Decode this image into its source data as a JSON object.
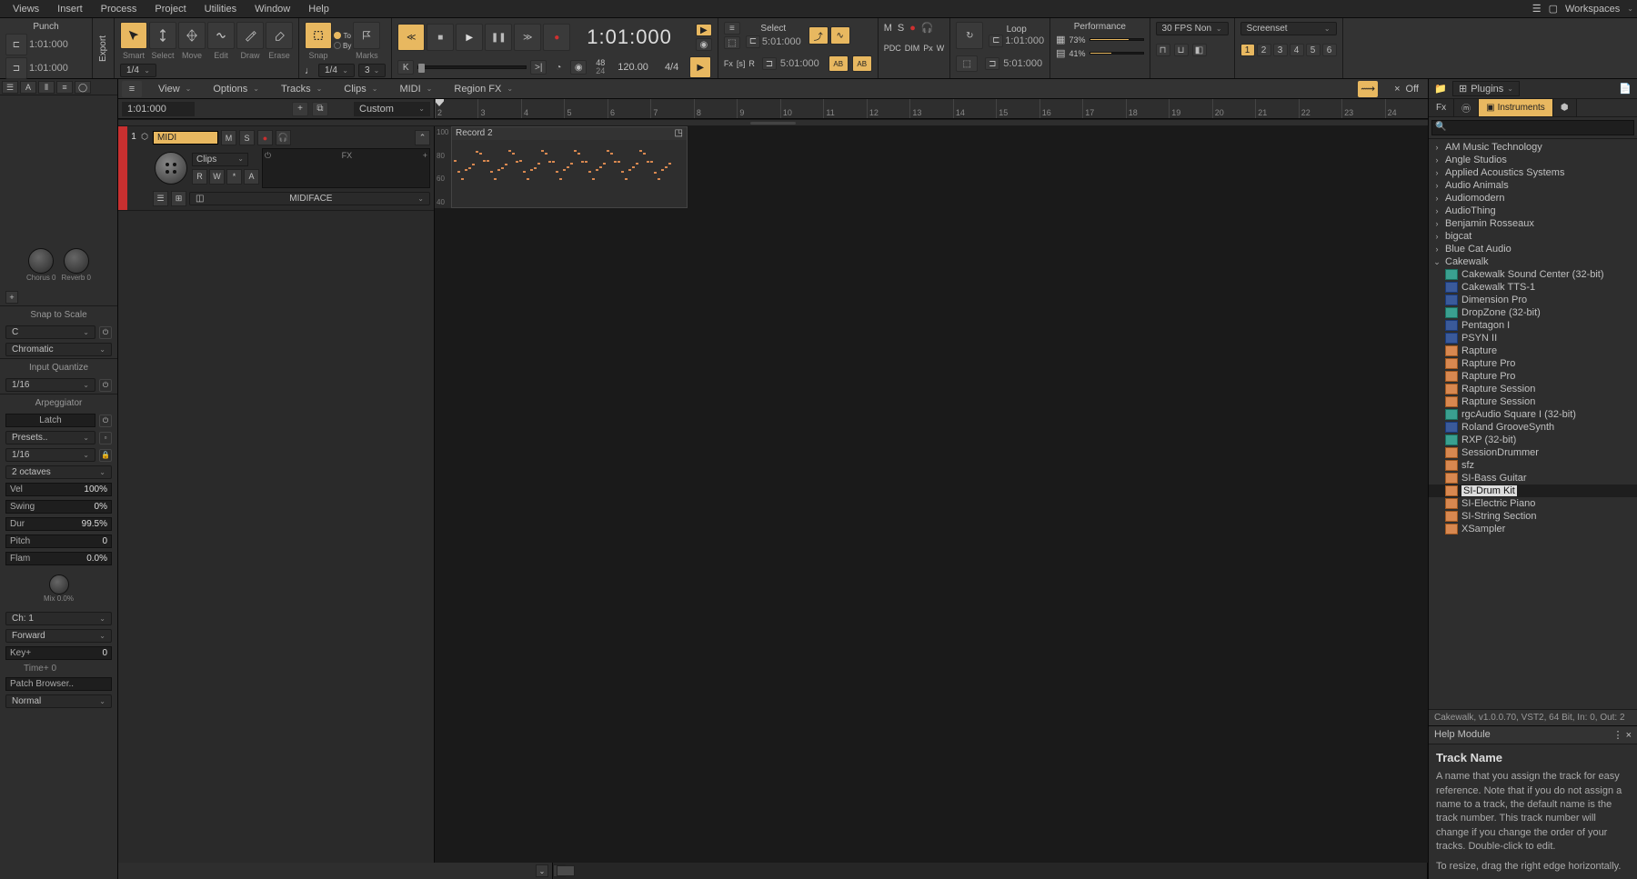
{
  "menu": {
    "items": [
      "Views",
      "Insert",
      "Process",
      "Project",
      "Utilities",
      "Window",
      "Help"
    ],
    "workspaces": "Workspaces"
  },
  "toolbar": {
    "punch": {
      "label": "Punch",
      "in": "1:01:000",
      "out": "1:01:000"
    },
    "export": "Export",
    "tools": {
      "smart": "Smart",
      "select": "Select",
      "move": "Move",
      "edit": "Edit",
      "draw": "Draw",
      "erase": "Erase"
    },
    "snap": {
      "label": "Snap",
      "toby": "To\nBy",
      "marks": "Marks",
      "val1": "1/4",
      "val2": "1/4",
      "step": "3"
    },
    "transport": {
      "now": "1:01:000",
      "meas": "48",
      "beat": "24",
      "tempo": "120.00",
      "sig": "4/4"
    },
    "select": {
      "label": "Select",
      "from": "5:01:000",
      "to": "5:01:000",
      "fx": "Fx",
      "s": "[s]",
      "r": "R",
      "ab1": "AB",
      "ab2": "AB"
    },
    "mix": {
      "m": "M",
      "s": "S",
      "pdc": "PDC",
      "dim": "DIM",
      "px": "Px",
      "w": "W"
    },
    "loop": {
      "label": "Loop",
      "from": "1:01:000",
      "to": "5:01:000"
    },
    "perf": {
      "label": "Performance",
      "cpu_pct": "73%",
      "disk_pct": "41%",
      "cpu": 73,
      "disk": 41
    },
    "fps": "30 FPS Non",
    "screenset_label": "Screenset",
    "screenset": [
      "1",
      "2",
      "3",
      "4",
      "5",
      "6"
    ]
  },
  "trackbar": {
    "view": "View",
    "options": "Options",
    "tracks": "Tracks",
    "clips": "Clips",
    "midi": "MIDI",
    "regionfx": "Region FX",
    "off": "Off"
  },
  "trackheader": {
    "pos": "1:01:000",
    "custom": "Custom",
    "marks": [
      "2",
      "3",
      "4",
      "5",
      "6",
      "7",
      "8",
      "9",
      "10",
      "11",
      "12",
      "13",
      "14",
      "15",
      "16",
      "17",
      "18",
      "19",
      "20",
      "21",
      "22",
      "23",
      "24"
    ]
  },
  "track1": {
    "num": "1",
    "name": "MIDI",
    "m": "M",
    "s": "S",
    "clips": "Clips",
    "r": "R",
    "w": "W",
    "star": "*",
    "a": "A",
    "midiface": "MIDIFACE",
    "fx": "FX"
  },
  "clip": {
    "name": "Record 2",
    "vel": [
      "100",
      "80",
      "60",
      "40"
    ]
  },
  "inspector": {
    "chorus": "Chorus 0",
    "reverb": "Reverb 0",
    "snap_scale": "Snap to Scale",
    "key": "C",
    "scale": "Chromatic",
    "input_q": "Input Quantize",
    "iq_val": "1/16",
    "arp": "Arpeggiator",
    "latch": "Latch",
    "presets": "Presets..",
    "rate": "1/16",
    "octaves": "2 octaves",
    "vel": "Vel",
    "vel_v": "100%",
    "swing": "Swing",
    "swing_v": "0%",
    "dur": "Dur",
    "dur_v": "99.5%",
    "pitch": "Pitch",
    "pitch_v": "0",
    "flam": "Flam",
    "flam_v": "0.0%",
    "mix": "Mix 0.0%",
    "ch": "Ch: 1",
    "fwd": "Forward",
    "keyplus": "Key+",
    "keyplus_v": "0",
    "timeplus": "Time+ 0",
    "patch": "Patch Browser..",
    "normal": "Normal"
  },
  "browser": {
    "plugins": "Plugins",
    "tabs": {
      "fx": "Fx",
      "inst": "Instruments"
    },
    "search_ph": "",
    "vendors": [
      "AM Music Technology",
      "Angle Studios",
      "Applied Acoustics Systems",
      "Audio Animals",
      "Audiomodern",
      "AudioThing",
      "Benjamin Rosseaux",
      "bigcat",
      "Blue Cat Audio",
      "Cakewalk"
    ],
    "cakewalk_items": [
      {
        "name": "Cakewalk Sound Center (32-bit)",
        "ico": "teal"
      },
      {
        "name": "Cakewalk TTS-1",
        "ico": "navy"
      },
      {
        "name": "Dimension Pro",
        "ico": "navy"
      },
      {
        "name": "DropZone (32-bit)",
        "ico": "teal"
      },
      {
        "name": "Pentagon I",
        "ico": "navy"
      },
      {
        "name": "PSYN II",
        "ico": "navy"
      },
      {
        "name": "Rapture",
        "ico": "orange"
      },
      {
        "name": "Rapture Pro",
        "ico": "orange"
      },
      {
        "name": "Rapture Pro",
        "ico": "orange"
      },
      {
        "name": "Rapture Session",
        "ico": "orange"
      },
      {
        "name": "Rapture Session",
        "ico": "orange"
      },
      {
        "name": "rgcAudio Square I (32-bit)",
        "ico": "teal"
      },
      {
        "name": "Roland GrooveSynth",
        "ico": "navy"
      },
      {
        "name": "RXP (32-bit)",
        "ico": "teal"
      },
      {
        "name": "SessionDrummer",
        "ico": "orange"
      },
      {
        "name": "sfz",
        "ico": "orange"
      },
      {
        "name": "SI-Bass Guitar",
        "ico": "orange"
      },
      {
        "name": "SI-Drum Kit",
        "ico": "orange",
        "selected": true
      },
      {
        "name": "SI-Electric Piano",
        "ico": "orange"
      },
      {
        "name": "SI-String Section",
        "ico": "orange"
      },
      {
        "name": "XSampler",
        "ico": "orange"
      }
    ],
    "status": "Cakewalk, v1.0.0.70, VST2, 64 Bit, In: 0, Out: 2"
  },
  "help": {
    "module": "Help Module",
    "title": "Track Name",
    "p1": "A name that you assign the track for easy reference. Note that if you do not assign a name to a track, the default name is the track number. This track number will change if you change the order of your tracks. Double-click to edit.",
    "p2": "To resize, drag the right edge horizontally."
  }
}
